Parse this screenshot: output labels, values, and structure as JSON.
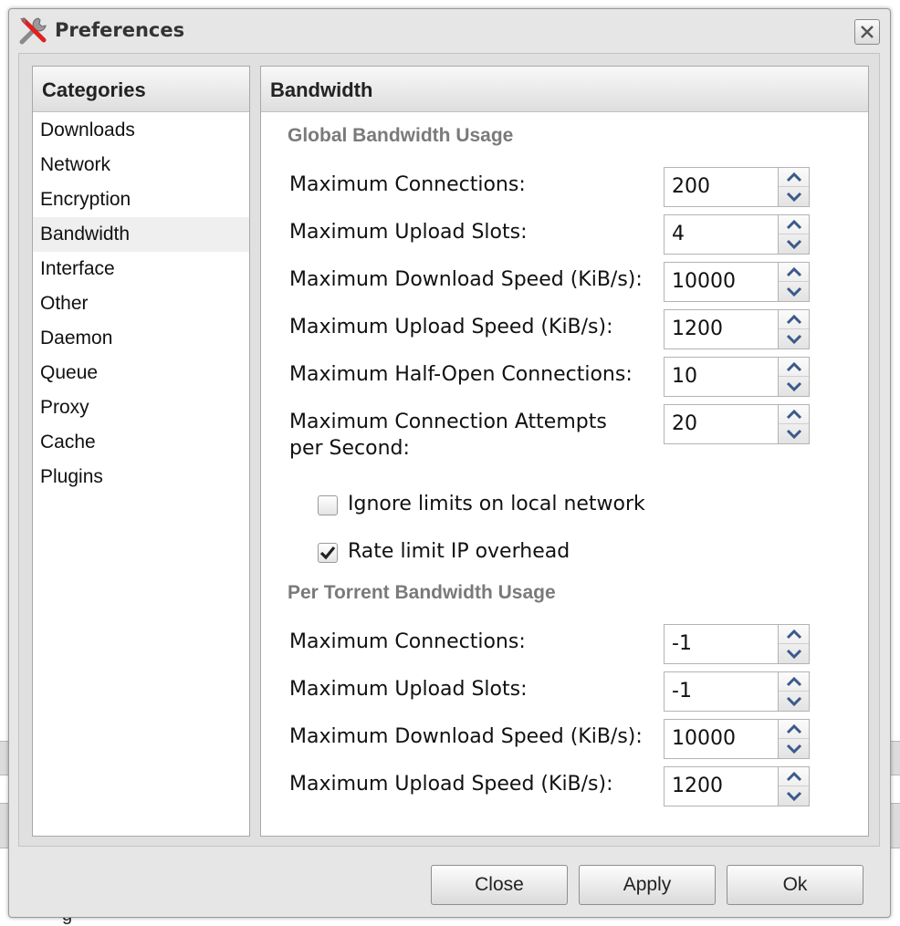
{
  "window": {
    "title": "Preferences",
    "icon": "tools-icon",
    "close_icon": "close-icon"
  },
  "categories": {
    "header": "Categories",
    "selected": "Bandwidth",
    "items": [
      "Downloads",
      "Network",
      "Encryption",
      "Bandwidth",
      "Interface",
      "Other",
      "Daemon",
      "Queue",
      "Proxy",
      "Cache",
      "Plugins"
    ]
  },
  "content": {
    "header": "Bandwidth",
    "global": {
      "title": "Global Bandwidth Usage",
      "fields": [
        {
          "label": "Maximum Connections:",
          "value": "200"
        },
        {
          "label": "Maximum Upload Slots:",
          "value": "4"
        },
        {
          "label": "Maximum Download Speed (KiB/s):",
          "value": "10000"
        },
        {
          "label": "Maximum Upload Speed (KiB/s):",
          "value": "1200"
        },
        {
          "label": "Maximum Half-Open Connections:",
          "value": "10"
        },
        {
          "label": "Maximum Connection Attempts per Second:",
          "value": "20"
        }
      ],
      "checkboxes": [
        {
          "label": "Ignore limits on local network",
          "checked": false
        },
        {
          "label": "Rate limit IP overhead",
          "checked": true
        }
      ]
    },
    "per_torrent": {
      "title": "Per Torrent Bandwidth Usage",
      "fields": [
        {
          "label": "Maximum Connections:",
          "value": "-1"
        },
        {
          "label": "Maximum Upload Slots:",
          "value": "-1"
        },
        {
          "label": "Maximum Download Speed (KiB/s):",
          "value": "10000"
        },
        {
          "label": "Maximum Upload Speed (KiB/s):",
          "value": "1200"
        }
      ]
    }
  },
  "buttons": {
    "close": "Close",
    "apply": "Apply",
    "ok": "Ok"
  },
  "colors": {
    "section_title": "#7a7a7a",
    "spinner_arrow": "#3b5a8a",
    "panel_border": "#a8a8a8"
  }
}
